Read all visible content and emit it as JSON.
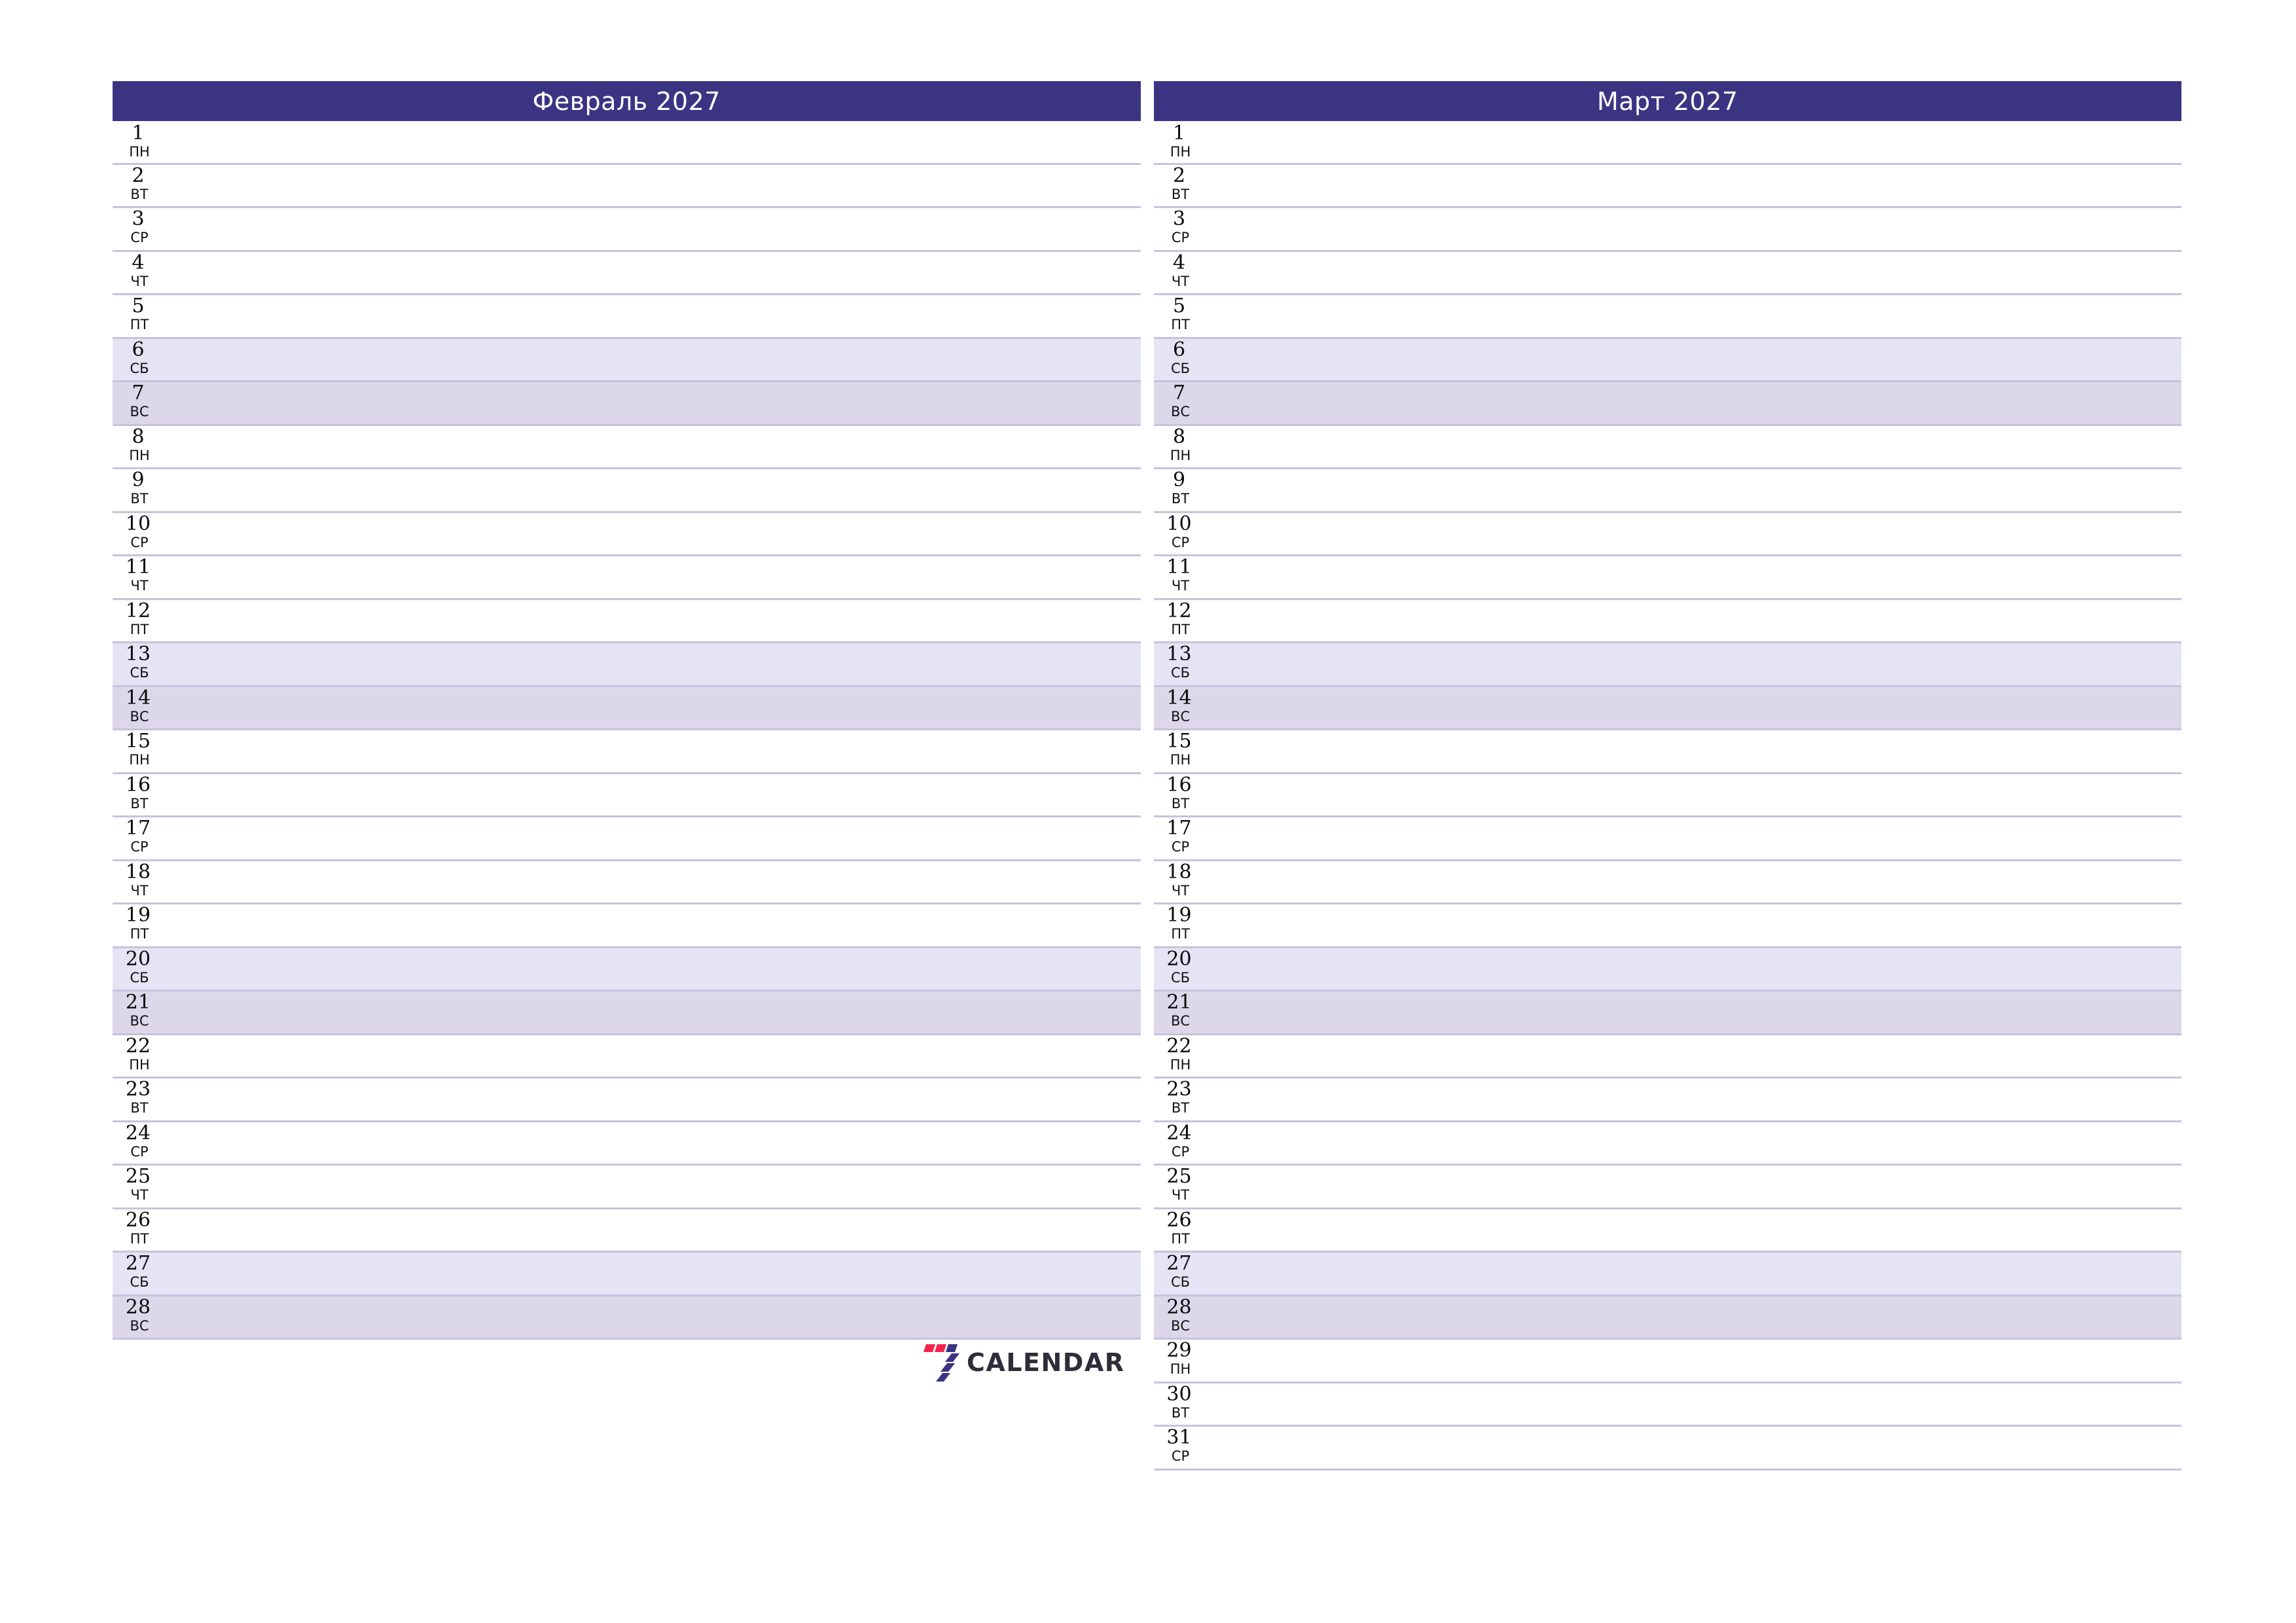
{
  "page": {
    "orientation": "landscape",
    "background_color": "#ffffff",
    "accent_color": "#3b3483",
    "row_line_color": "#c5c3dd",
    "saturday_color": "#e4e4f5",
    "sunday_color": "#dcd8ea",
    "text_color": "#111111"
  },
  "logo": {
    "mark_name": "seven-calendar-logo-icon",
    "text": "CALENDAR",
    "red": "#f4244a",
    "blue": "#3b3483",
    "wordmark_color": "#2e2e3a"
  },
  "months": [
    {
      "title": "Февраль 2027",
      "name": "Февраль",
      "year": "2027",
      "days": [
        {
          "num": "1",
          "dow": "пн",
          "type": "weekday"
        },
        {
          "num": "2",
          "dow": "вт",
          "type": "weekday"
        },
        {
          "num": "3",
          "dow": "ср",
          "type": "weekday"
        },
        {
          "num": "4",
          "dow": "чт",
          "type": "weekday"
        },
        {
          "num": "5",
          "dow": "пт",
          "type": "weekday"
        },
        {
          "num": "6",
          "dow": "сб",
          "type": "sat"
        },
        {
          "num": "7",
          "dow": "вс",
          "type": "sun"
        },
        {
          "num": "8",
          "dow": "пн",
          "type": "weekday"
        },
        {
          "num": "9",
          "dow": "вт",
          "type": "weekday"
        },
        {
          "num": "10",
          "dow": "ср",
          "type": "weekday"
        },
        {
          "num": "11",
          "dow": "чт",
          "type": "weekday"
        },
        {
          "num": "12",
          "dow": "пт",
          "type": "weekday"
        },
        {
          "num": "13",
          "dow": "сб",
          "type": "sat"
        },
        {
          "num": "14",
          "dow": "вс",
          "type": "sun"
        },
        {
          "num": "15",
          "dow": "пн",
          "type": "weekday"
        },
        {
          "num": "16",
          "dow": "вт",
          "type": "weekday"
        },
        {
          "num": "17",
          "dow": "ср",
          "type": "weekday"
        },
        {
          "num": "18",
          "dow": "чт",
          "type": "weekday"
        },
        {
          "num": "19",
          "dow": "пт",
          "type": "weekday"
        },
        {
          "num": "20",
          "dow": "сб",
          "type": "sat"
        },
        {
          "num": "21",
          "dow": "вс",
          "type": "sun"
        },
        {
          "num": "22",
          "dow": "пн",
          "type": "weekday"
        },
        {
          "num": "23",
          "dow": "вт",
          "type": "weekday"
        },
        {
          "num": "24",
          "dow": "ср",
          "type": "weekday"
        },
        {
          "num": "25",
          "dow": "чт",
          "type": "weekday"
        },
        {
          "num": "26",
          "dow": "пт",
          "type": "weekday"
        },
        {
          "num": "27",
          "dow": "сб",
          "type": "sat"
        },
        {
          "num": "28",
          "dow": "вс",
          "type": "sun"
        }
      ]
    },
    {
      "title": "Март 2027",
      "name": "Март",
      "year": "2027",
      "days": [
        {
          "num": "1",
          "dow": "пн",
          "type": "weekday"
        },
        {
          "num": "2",
          "dow": "вт",
          "type": "weekday"
        },
        {
          "num": "3",
          "dow": "ср",
          "type": "weekday"
        },
        {
          "num": "4",
          "dow": "чт",
          "type": "weekday"
        },
        {
          "num": "5",
          "dow": "пт",
          "type": "weekday"
        },
        {
          "num": "6",
          "dow": "сб",
          "type": "sat"
        },
        {
          "num": "7",
          "dow": "вс",
          "type": "sun"
        },
        {
          "num": "8",
          "dow": "пн",
          "type": "weekday"
        },
        {
          "num": "9",
          "dow": "вт",
          "type": "weekday"
        },
        {
          "num": "10",
          "dow": "ср",
          "type": "weekday"
        },
        {
          "num": "11",
          "dow": "чт",
          "type": "weekday"
        },
        {
          "num": "12",
          "dow": "пт",
          "type": "weekday"
        },
        {
          "num": "13",
          "dow": "сб",
          "type": "sat"
        },
        {
          "num": "14",
          "dow": "вс",
          "type": "sun"
        },
        {
          "num": "15",
          "dow": "пн",
          "type": "weekday"
        },
        {
          "num": "16",
          "dow": "вт",
          "type": "weekday"
        },
        {
          "num": "17",
          "dow": "ср",
          "type": "weekday"
        },
        {
          "num": "18",
          "dow": "чт",
          "type": "weekday"
        },
        {
          "num": "19",
          "dow": "пт",
          "type": "weekday"
        },
        {
          "num": "20",
          "dow": "сб",
          "type": "sat"
        },
        {
          "num": "21",
          "dow": "вс",
          "type": "sun"
        },
        {
          "num": "22",
          "dow": "пн",
          "type": "weekday"
        },
        {
          "num": "23",
          "dow": "вт",
          "type": "weekday"
        },
        {
          "num": "24",
          "dow": "ср",
          "type": "weekday"
        },
        {
          "num": "25",
          "dow": "чт",
          "type": "weekday"
        },
        {
          "num": "26",
          "dow": "пт",
          "type": "weekday"
        },
        {
          "num": "27",
          "dow": "сб",
          "type": "sat"
        },
        {
          "num": "28",
          "dow": "вс",
          "type": "sun"
        },
        {
          "num": "29",
          "dow": "пн",
          "type": "weekday"
        },
        {
          "num": "30",
          "dow": "вт",
          "type": "weekday"
        },
        {
          "num": "31",
          "dow": "ср",
          "type": "weekday"
        }
      ]
    }
  ]
}
